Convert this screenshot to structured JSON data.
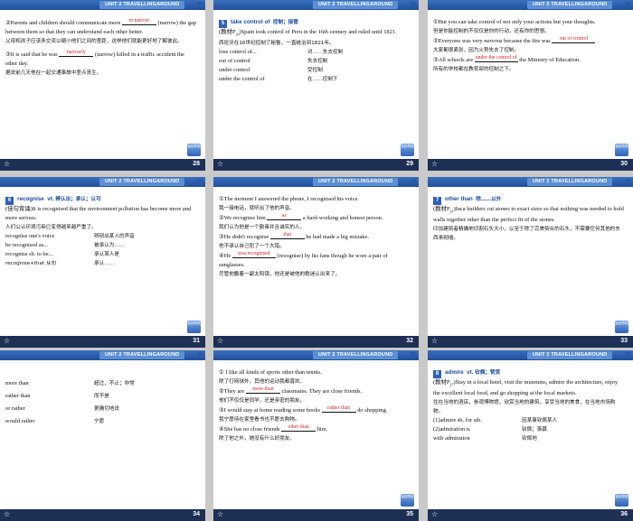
{
  "header_tag": "UNIT 2 TRAVELLINGAROUND",
  "nav_btn": "返回导航",
  "slides": [
    {
      "num": "28",
      "b1": "②Parents and children should communicate more ",
      "blank1": "to narrow",
      "b1b": " (narrow) the gap between them so that they can understand each other better.",
      "c1": "父母和孩子应该多交流以缩小他们之间的差距，这样他们就能更好地了解彼此。",
      "b2": "③It is said that he was ",
      "blank2": "narrowly",
      "b2b": " (narrow) killed in a traffic accident the other day.",
      "c2": "据说前几天他在一起交通事故中差点丧生。"
    },
    {
      "num": "29",
      "badge": "5",
      "head_en": "take control of",
      "head_cn": "控制；接管",
      "p1": "(教材P",
      "p1sub": "30",
      "p1b": ")Spain took control of Peru in the 16th century and ruled until 1821.",
      "c1": "西班牙在16世纪控制了秘鲁，一直统治到1821年。",
      "rows": [
        {
          "l": "lose control of...",
          "r": "对……失去控制"
        },
        {
          "l": "out of control",
          "r": "失去控制"
        },
        {
          "l": "under control",
          "r": "受控制"
        },
        {
          "l": "under the control of",
          "r": "在……控制下"
        }
      ]
    },
    {
      "num": "30",
      "b1": "①But you can take control of not only your actions but your thoughts.",
      "c1": "但是你能控制的不仅仅是你的行动，还有你的思想。",
      "b2": "②Everyone was very nervous because the fire was ",
      "blank2": "out of control",
      "c2": "大家都很紧张，因为火势失去了控制。",
      "b3": "③All schools are ",
      "blank3": "under the control of",
      "b3b": " the Ministry of Education.",
      "c3": "所有的学校都在教育部的控制之下。"
    },
    {
      "num": "31",
      "badge": "6",
      "head_en": "recognise",
      "head_pos": "vt.",
      "head_cn": "辨认出；承认；认可",
      "p1": "(佳句背诵)It is recognised that the environment pollution has become more and more serious.",
      "c1": "人们公认环境污染已变得越来越严重了。",
      "rows": [
        {
          "l": "recognise one's voice",
          "r": "辨别出某人的声音"
        },
        {
          "l": "be recognised as...",
          "r": "被承认为……"
        },
        {
          "l": "recognise sb. to be...",
          "r": "承认某人是"
        },
        {
          "l": "recognise+that 从句",
          "r": "承认……"
        }
      ]
    },
    {
      "num": "32",
      "b1": "①The moment I answered the phone, I recognised his voice.",
      "c1": "我一接电话，就听出了他的声音。",
      "b2": "②We recognise him ",
      "blank2": "as",
      "b2b": " a hard-working and honest person.",
      "c2": "我们认为他是一个勤奋并且诚实的人。",
      "b3": "③He didn't recognise ",
      "blank3": "that",
      "b3b": " he had made a big mistake.",
      "c3": "他不承认自己犯了一个大错。",
      "b4": "④He ",
      "blank4": "was recognised",
      "b4b": " (recognise) by his fans though he wore a pair of sunglasses.",
      "c4": "尽管他戴着一副太阳镜，他还是被他的歌迷认出来了。"
    },
    {
      "num": "33",
      "badge": "7",
      "head_en": "other than",
      "head_cn": "除……以外",
      "p1": "(教材P",
      "p1sub": "31",
      "p1b": ")Inca builders cut stones to exact sizes so that nothing was needed to hold walls together other than the perfect fit of the stones.",
      "c1": "印加建筑者精确地切割石头大小，以至于除了完美契合的石头，不需要任何其他的东西来砌墙。"
    },
    {
      "num": "34",
      "rows": [
        {
          "l": "more than",
          "r": "超过，不止；非常"
        },
        {
          "l": "rather than",
          "r": "而不是"
        },
        {
          "l": "or rather",
          "r": "更确切地说"
        },
        {
          "l": "would rather",
          "r": "宁愿"
        }
      ]
    },
    {
      "num": "35",
      "b1": "① I like all kinds of sports other than tennis.",
      "c1": "除了打网球外，其他的运动我都喜欢。",
      "b2": "②They are ",
      "blank2": "more than",
      "b2b": " classmates. They are close friends.",
      "c2": "他们不仅仅是同学，还是亲密的朋友。",
      "b3": "③I would stay at home reading some books ",
      "blank3": "rather than",
      "b3b": " do shopping.",
      "c3": "我宁愿待在家里看书也不愿去购物。",
      "b4": "④She has no close friends ",
      "blank4": "other than",
      "b4b": " him.",
      "c4": "除了他之外，她没有什么好朋友。"
    },
    {
      "num": "36",
      "badge": "8",
      "head_en": "admire",
      "head_pos": "vt.",
      "head_cn": "钦佩；赞赏",
      "p1": "(教材P",
      "p1sub": "27",
      "p1b": ")Stay in a local hotel, visit the museums, admire the architecture, enjoy the excellent local food, and go shopping at the local markets.",
      "c1": "住在当地的酒店，参观博物馆，欣赏当地的建筑，享受当地的美食，在当地市场购物。",
      "rows": [
        {
          "l": "(1)admire sb. for sth.",
          "r": "因某事钦佩某人"
        },
        {
          "l": "(2)admiration n.",
          "r": "钦佩；羡慕"
        },
        {
          "l": "with admiration",
          "r": "钦佩地"
        }
      ]
    }
  ]
}
